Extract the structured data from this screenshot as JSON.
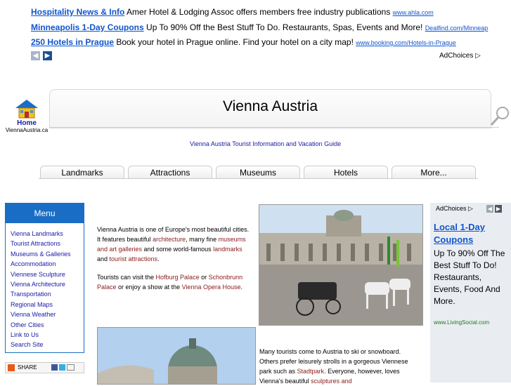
{
  "ads": [
    {
      "title": "Hospitality News & Info",
      "text": " Amer Hotel & Lodging Assoc offers members free industry publications ",
      "url": "www.ahla.com"
    },
    {
      "title": "Minneapolis 1-Day Coupons",
      "text": " Up To 90% Off the Best Stuff To Do. Restaurants, Spas, Events and More! ",
      "url": "Dealfind.com/Minneap"
    },
    {
      "title": "250 Hotels in Prague",
      "text": " Book your hotel in Prague online. Find your hotel on a city map! ",
      "url": "www.booking.com/Hotels-in-Prague"
    }
  ],
  "adchoices": "AdChoices",
  "header": {
    "home": "Home",
    "site": "ViennaAustria.ca",
    "title": "Vienna Austria",
    "tagline": "Vienna Austria Tourist Information and Vacation Guide"
  },
  "tabs": [
    "Landmarks",
    "Attractions",
    "Museums",
    "Hotels",
    "More..."
  ],
  "menu": {
    "title": "Menu",
    "items": [
      "Vienna Landmarks",
      "Tourist Attractions",
      "Museums & Galleries",
      "Accommodation",
      "Viennese Sculpture",
      "Vienna Architecture",
      "Transportation",
      "Regional Maps",
      "Vienna Weather",
      "Other Cities",
      "Link to Us",
      "Search Site"
    ]
  },
  "share": "SHARE",
  "content": {
    "p1a": "Vienna Austria is one of Europe's most beautiful cities. It features beautiful ",
    "p1_link1": "architecture",
    "p1b": ", many fine ",
    "p1_link2": "museums and art galleries",
    "p1c": " and some world-famous ",
    "p1_link3": "landmarks",
    "p1d": " and ",
    "p1_link4": "tourist attractions",
    "p1e": ".",
    "p2a": "Tourists can visit the ",
    "p2_link1": "Hofburg Palace",
    "p2b": " or ",
    "p2_link2": "Schonbrunn Palace",
    "p2c": " or enjoy a show at the ",
    "p2_link3": "Vienna Opera House",
    "p2d": ".",
    "p3a": "Many tourists come to Austria to ski or snowboard. Others prefer leisurely strolls in a gorgeous Viennese park such as ",
    "p3_link1": "Stadtpark",
    "p3b": ". Everyone, however, loves Vienna's beautiful ",
    "p3_link2": "sculptures and"
  },
  "right_ad": {
    "choices": "AdChoices",
    "title": "Local 1-Day Coupons",
    "desc": "Up To 90% Off The Best Stuff To Do! Restaurants, Events, Food And More.",
    "url": "www.LivingSocial.com"
  },
  "colors": {
    "menu_blue": "#1a6dc4",
    "link_blue": "#1155cc",
    "content_link": "#8b1a1a",
    "ad_bg": "#e9edf2"
  }
}
